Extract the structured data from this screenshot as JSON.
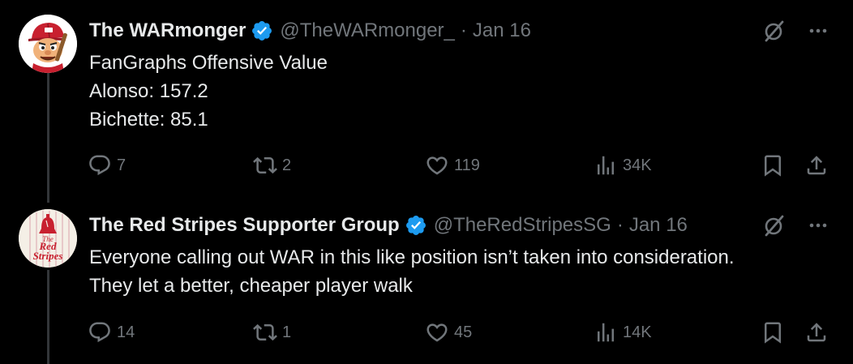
{
  "colors": {
    "background": "#000000",
    "primary_text": "#e7e9ea",
    "secondary_text": "#71767b",
    "verified_blue": "#1d9bf0",
    "thread_line": "#333639"
  },
  "tweets": [
    {
      "display_name": "The WARmonger",
      "handle": "@TheWARmonger_",
      "separator": "·",
      "date": "Jan 16",
      "avatar_icon": "cartoon-baseball-mascot-avatar",
      "lines": [
        "FanGraphs Offensive Value",
        "Alonso: 157.2",
        "Bichette: 85.1"
      ],
      "replies": "7",
      "reposts": "2",
      "likes": "119",
      "views": "34K"
    },
    {
      "display_name": "The Red Stripes Supporter Group",
      "handle": "@TheRedStripesSG",
      "separator": "·",
      "date": "Jan 16",
      "avatar_icon": "red-stripes-liberty-bell-logo-avatar",
      "avatar_logo_text": "The Red Stripes",
      "lines": [
        "Everyone calling out WAR in this like position isn’t taken into consideration.",
        "They let a better, cheaper player walk"
      ],
      "replies": "14",
      "reposts": "1",
      "likes": "45",
      "views": "14K"
    }
  ]
}
